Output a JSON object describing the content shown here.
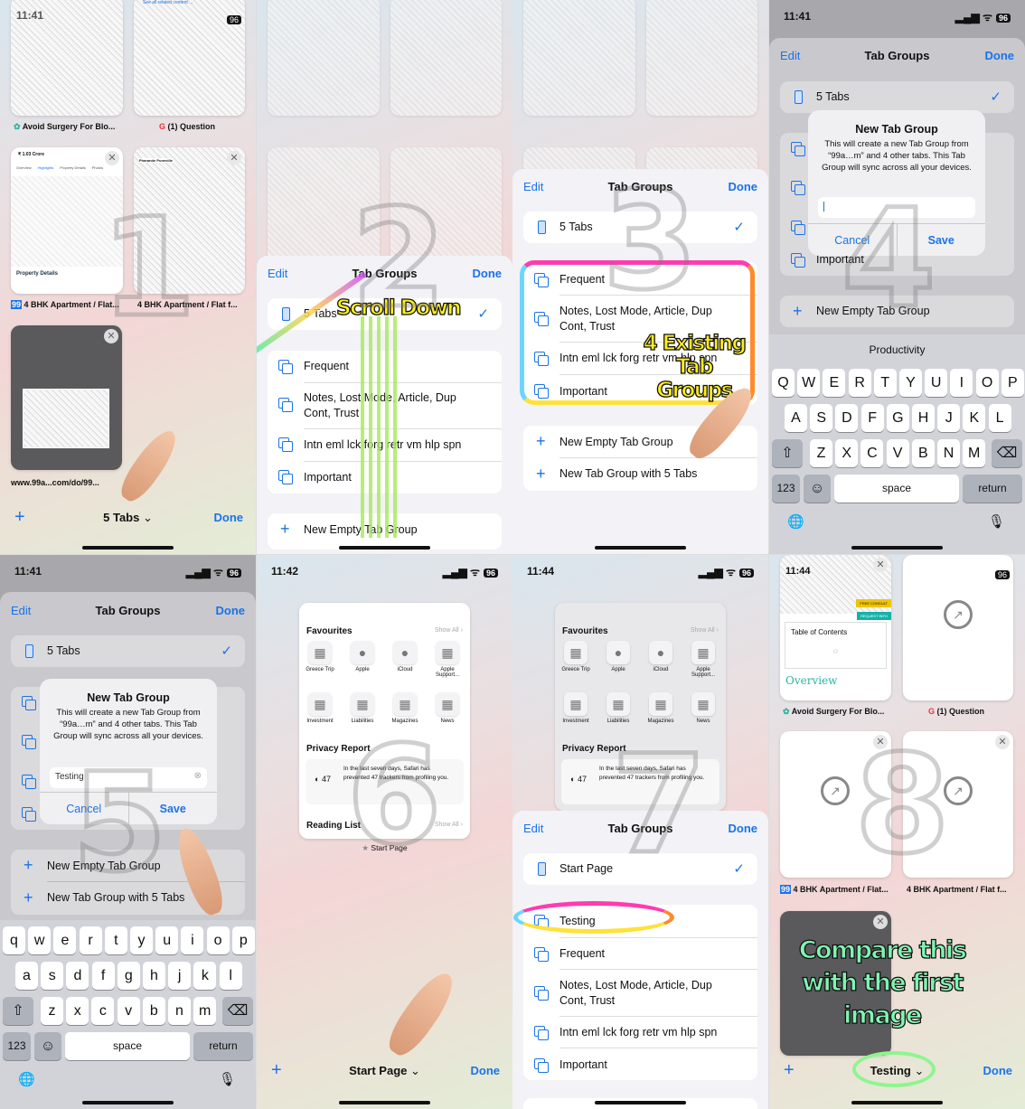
{
  "status": {
    "battery": "96",
    "time_1": "11:41",
    "time_6": "11:42",
    "time_7": "11:44",
    "time_8": "11:44"
  },
  "tab_groups": {
    "edit": "Edit",
    "title": "Tab Groups",
    "done": "Done",
    "current": "5 Tabs",
    "start_page": "Start Page",
    "groups": [
      "Frequent",
      "Notes, Lost Mode, Article, Dup Cont, Trust",
      "Intn eml lck forg retr vm hlp spn",
      "Important"
    ],
    "new_group": "Testing",
    "new_empty": "New Empty Tab Group",
    "new_with_tabs": "New Tab Group with 5 Tabs"
  },
  "tabs": {
    "titles": [
      "Avoid Surgery For Blo...",
      "(1) Question",
      "4 BHK Apartment / Flat...",
      "4 BHK Apartment / Flat f...",
      "www.99a...com/do/99..."
    ],
    "site_badge": "99",
    "property_price": "₹ 1.03 Crore",
    "property_tabs": [
      "Overview",
      "Highlights",
      "Property Details",
      "Photos"
    ],
    "property_details": "Property Details",
    "property_locality": "Pharande Puneville",
    "see_all": "See all related content →",
    "toc": "Table of Contents",
    "overview": "Overview",
    "free_consult": "FREE CONSULT",
    "request_info": "REQUEST INFO"
  },
  "bottom_bar": {
    "plus": "+",
    "group_1": "5 Tabs",
    "group_6": "Start Page",
    "group_8": "Testing",
    "done": "Done",
    "chevron": "⌄"
  },
  "dialog": {
    "title": "New Tab Group",
    "message": "This will create a new Tab Group from “99a…m” and 4 other tabs. This Tab Group will sync across all your devices.",
    "input_value": "Testing",
    "cancel": "Cancel",
    "save": "Save"
  },
  "keyboard": {
    "suggestion": "Productivity",
    "upper": [
      [
        "Q",
        "W",
        "E",
        "R",
        "T",
        "Y",
        "U",
        "I",
        "O",
        "P"
      ],
      [
        "A",
        "S",
        "D",
        "F",
        "G",
        "H",
        "J",
        "K",
        "L"
      ],
      [
        "Z",
        "X",
        "C",
        "V",
        "B",
        "N",
        "M"
      ]
    ],
    "lower": [
      [
        "q",
        "w",
        "e",
        "r",
        "t",
        "y",
        "u",
        "i",
        "o",
        "p"
      ],
      [
        "a",
        "s",
        "d",
        "f",
        "g",
        "h",
        "j",
        "k",
        "l"
      ],
      [
        "z",
        "x",
        "c",
        "v",
        "b",
        "n",
        "m"
      ]
    ],
    "numbers": "123",
    "space": "space",
    "return": "return",
    "emoji": "☺",
    "shift": "⇧",
    "delete": "⌫",
    "globe": "🌐",
    "mic": "🎙"
  },
  "start_page": {
    "favourites": "Favourites",
    "show_all": "Show All ›",
    "items": [
      "Greece Trip",
      "Apple",
      "iCloud",
      "Apple Support...",
      "Investment",
      "Liabilities",
      "Magazines",
      "News"
    ],
    "privacy_title": "Privacy Report",
    "tracker_count": "47",
    "privacy_text": "In the last seven days, Safari has prevented 47 trackers from profiling you.",
    "reading_list": "Reading List",
    "label": "Start Page"
  },
  "annotations": {
    "numbers": [
      "1",
      "2",
      "3",
      "4",
      "5",
      "6",
      "7",
      "8"
    ],
    "scroll_down": "Scroll Down",
    "existing": "4 Existing Tab Groups",
    "compare": "Compare this with the first image"
  },
  "colors": {
    "accent": "#1a73e8",
    "annotation_yellow": "#ffef1a",
    "annotation_green": "#7ff5b2",
    "highlight_ring": "rainbow",
    "testing_ring": "#8ef58e"
  }
}
